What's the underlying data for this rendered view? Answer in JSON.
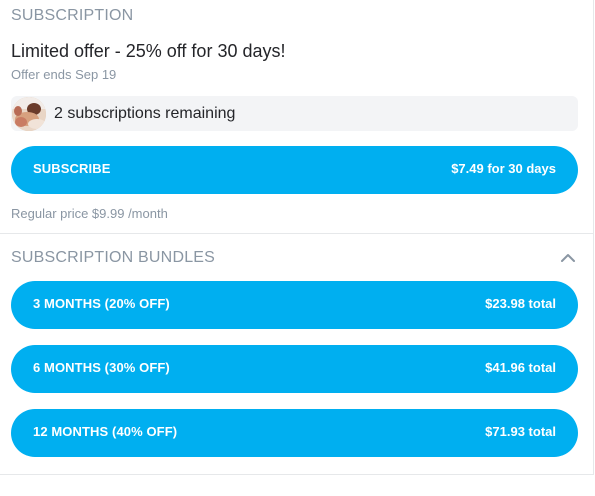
{
  "subscription": {
    "section_title": "SUBSCRIPTION",
    "offer_title": "Limited offer - 25% off for 30 days!",
    "offer_ends": "Offer ends Sep 19",
    "remaining": "2 subscriptions remaining",
    "subscribe_button": {
      "label": "SUBSCRIBE",
      "price": "$7.49 for 30 days"
    },
    "regular_price": "Regular price $9.99 /month"
  },
  "bundles": {
    "section_title": "SUBSCRIPTION BUNDLES",
    "items": [
      {
        "label": "3 MONTHS (20% off)",
        "total": "$23.98 total"
      },
      {
        "label": "6 MONTHS (30% off)",
        "total": "$41.96 total"
      },
      {
        "label": "12 MONTHS (40% off)",
        "total": "$71.93 total"
      }
    ]
  },
  "colors": {
    "accent": "#00aff0",
    "muted_text": "#8a96a3",
    "primary_text": "#242529",
    "panel_bg": "#f3f4f6"
  },
  "icons": {
    "collapse": "chevron-up-icon",
    "avatar": "avatar"
  }
}
